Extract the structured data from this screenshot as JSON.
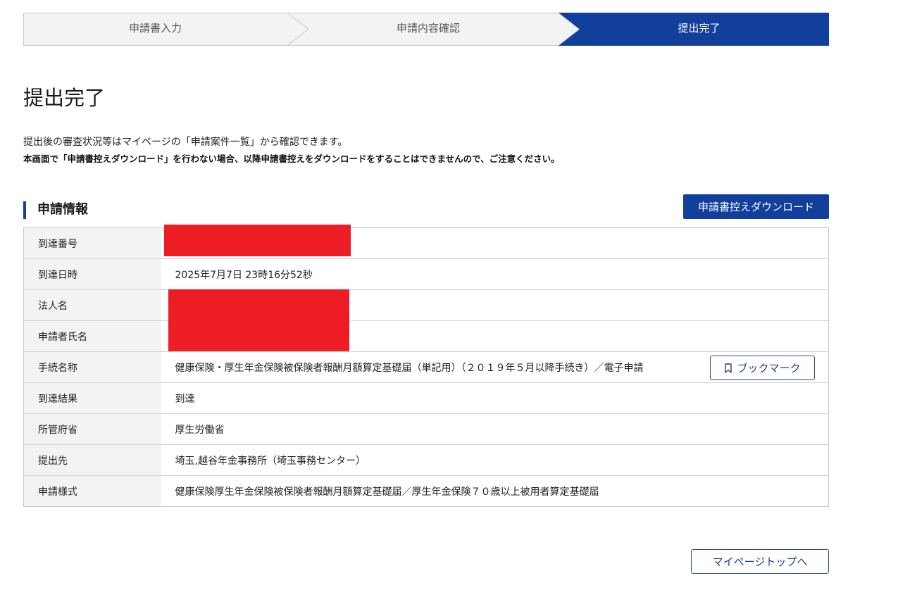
{
  "steps": [
    {
      "label": "申請書入力",
      "active": false
    },
    {
      "label": "申請内容確認",
      "active": false
    },
    {
      "label": "提出完了",
      "active": true
    }
  ],
  "page": {
    "title": "提出完了",
    "message1": "提出後の審査状況等はマイページの「申請案件一覧」から確認できます。",
    "message2": "本画面で「申請書控えダウンロード」を行わない場合、以降申請書控えをダウンロードをすることはできませんので、ご注意ください。"
  },
  "section": {
    "title": "申請情報",
    "download_button": "申請書控えダウンロード"
  },
  "table": {
    "rows": [
      {
        "label": "到達番号",
        "value": ""
      },
      {
        "label": "到達日時",
        "value": "2025年7月7日 23時16分52秒"
      },
      {
        "label": "法人名",
        "value": ""
      },
      {
        "label": "申請者氏名",
        "value": ""
      },
      {
        "label": "手続名称",
        "value": "健康保険・厚生年金保険被保険者報酬月額算定基礎届（単記用）（２０１９年５月以降手続き）／電子申請"
      },
      {
        "label": "到達結果",
        "value": "到達"
      },
      {
        "label": "所管府省",
        "value": "厚生労働省"
      },
      {
        "label": "提出先",
        "value": "埼玉,越谷年金事務所（埼玉事務センター）"
      },
      {
        "label": "申請様式",
        "value": "健康保険厚生年金保険被保険者報酬月額算定基礎届／厚生年金保険７０歳以上被用者算定基礎届"
      }
    ],
    "bookmark_label": "ブックマーク"
  },
  "footer": {
    "mypage_button": "マイページトップへ"
  },
  "colors": {
    "primary": "#123f9b",
    "redaction": "#ee1c25",
    "step_inactive": "#f2f3f5"
  },
  "icons": {
    "bookmark": "bookmark-icon"
  }
}
